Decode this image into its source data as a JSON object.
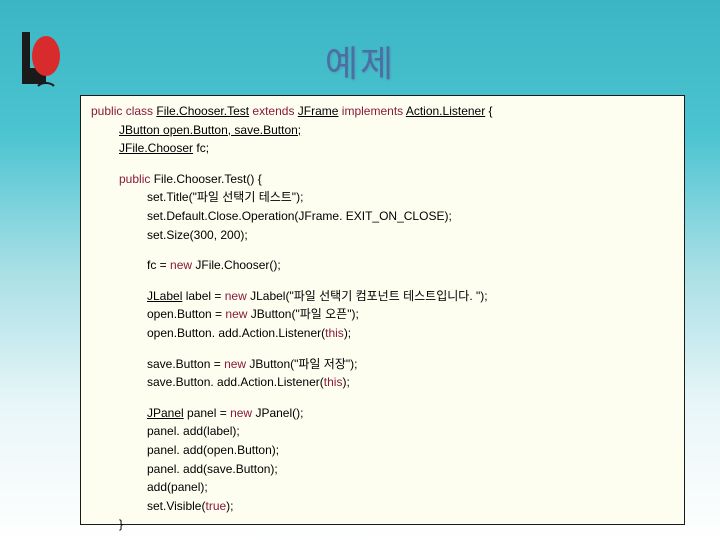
{
  "header": {
    "title": "예제"
  },
  "code": {
    "l1a": "public class ",
    "l1b": "File.Chooser.Test",
    "l1c": " extends ",
    "l1d": "JFrame",
    "l1e": " implements ",
    "l1f": "Action.Listener",
    "l1g": " {",
    "l2a": "JButton",
    "l2b": " open.Button, save.Button;",
    "l3a": "JFile.Chooser",
    "l3b": " fc;",
    "l4a": "public ",
    "l4b": "File.Chooser.Test() {",
    "l5": "set.Title(\"파일 선택기 테스트\");",
    "l6": "set.Default.Close.Operation(JFrame. EXIT_ON_CLOSE);",
    "l7": "set.Size(300, 200);",
    "l8a": "fc = ",
    "l8b": "new ",
    "l8c": "JFile.Chooser();",
    "l9a": "JLabel",
    "l9b": " label = ",
    "l9c": "new ",
    "l9d": "JLabel(\"파일 선택기 컴포넌트 테스트입니다. \");",
    "l10a": "open.Button = ",
    "l10b": "new ",
    "l10c": "JButton(\"파일 오픈\");",
    "l11a": "open.Button. add.Action.Listener(",
    "l11b": "this",
    "l11c": ");",
    "l12a": "save.Button = ",
    "l12b": "new ",
    "l12c": "JButton(\"파일 저장\");",
    "l13a": "save.Button. add.Action.Listener(",
    "l13b": "this",
    "l13c": ");",
    "l14a": "JPanel",
    "l14b": " panel = ",
    "l14c": "new ",
    "l14d": "JPanel();",
    "l15": "panel. add(label);",
    "l16": "panel. add(open.Button);",
    "l17": "panel. add(save.Button);",
    "l18": "add(panel);",
    "l19a": "set.Visible(",
    "l19b": "true",
    "l19c": ");",
    "l20": "}"
  }
}
